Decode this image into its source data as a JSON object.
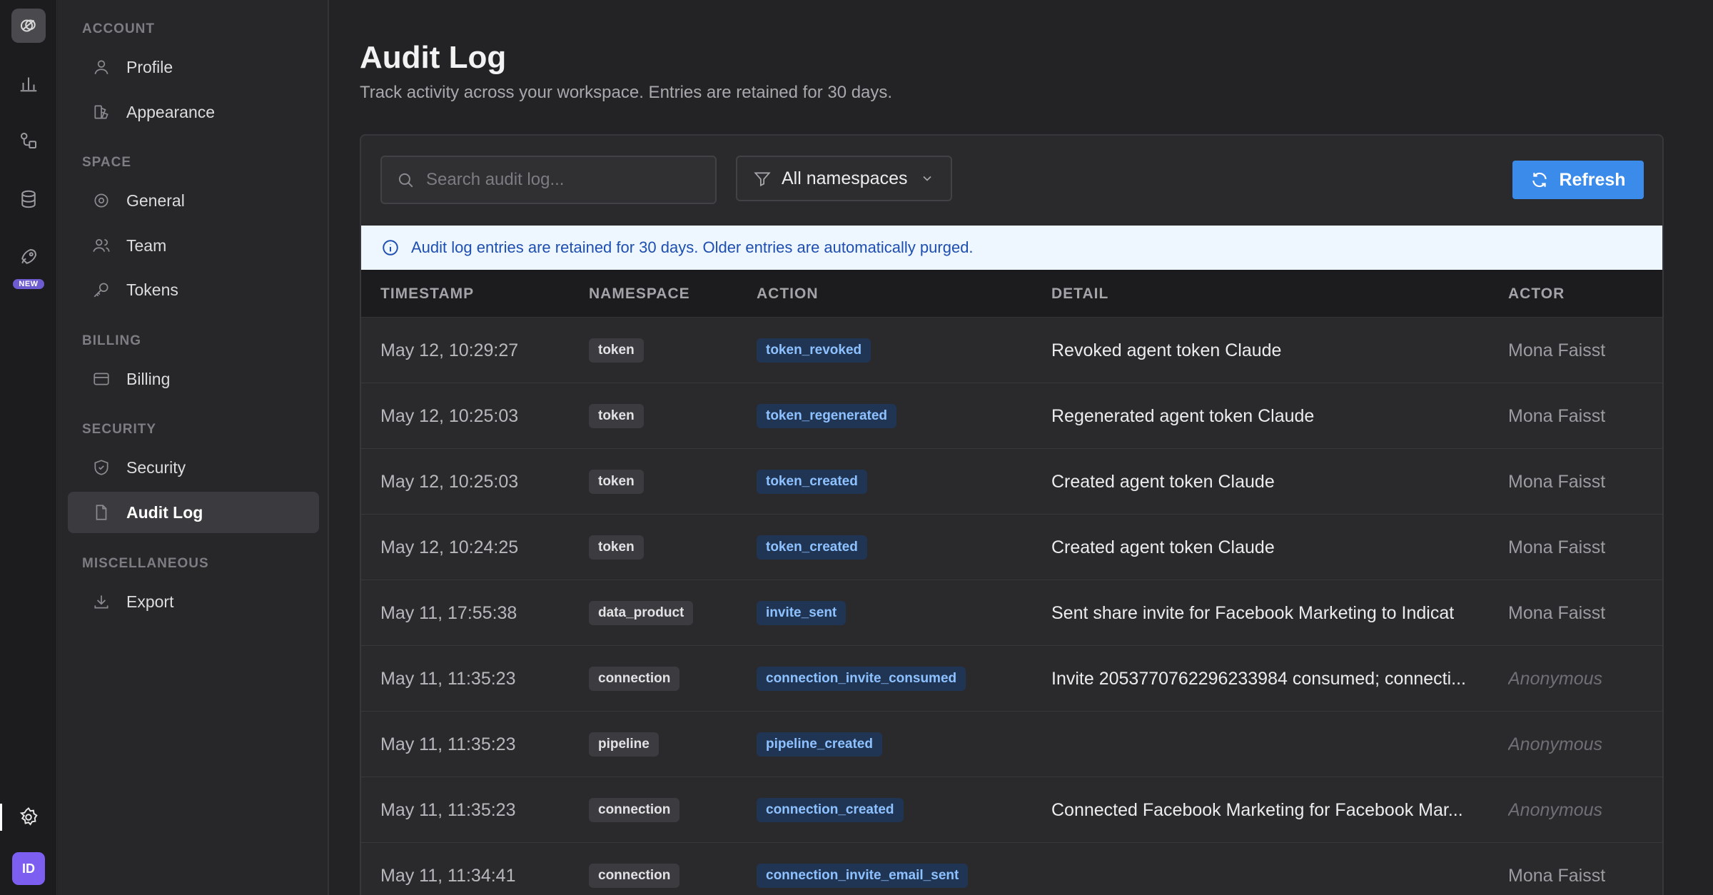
{
  "rail": {
    "new_badge": "NEW",
    "avatar_initials": "ID",
    "icons": [
      "logo-icon",
      "chart-icon",
      "pipeline-icon",
      "database-icon",
      "rocket-icon",
      "gear-icon"
    ]
  },
  "sidebar": {
    "sections": {
      "account": "ACCOUNT",
      "space": "SPACE",
      "billing": "BILLING",
      "security": "SECURITY",
      "misc": "MISCELLANEOUS"
    },
    "items": {
      "profile": "Profile",
      "appearance": "Appearance",
      "general": "General",
      "team": "Team",
      "tokens": "Tokens",
      "billing": "Billing",
      "security": "Security",
      "audit_log": "Audit Log",
      "export": "Export"
    },
    "active": "audit_log"
  },
  "main": {
    "title": "Audit Log",
    "subtitle": "Track activity across your workspace. Entries are retained for 30 days.",
    "search_placeholder": "Search audit log...",
    "namespace_filter": "All namespaces",
    "refresh_label": "Refresh",
    "info_banner": "Audit log entries are retained for 30 days. Older entries are automatically purged.",
    "columns": {
      "timestamp": "TIMESTAMP",
      "namespace": "NAMESPACE",
      "action": "ACTION",
      "detail": "DETAIL",
      "actor": "ACTOR"
    },
    "rows": [
      {
        "timestamp": "May 12, 10:29:27",
        "namespace": "token",
        "action": "token_revoked",
        "detail": "Revoked agent token Claude",
        "actor": "Mona Faisst"
      },
      {
        "timestamp": "May 12, 10:25:03",
        "namespace": "token",
        "action": "token_regenerated",
        "detail": "Regenerated agent token Claude",
        "actor": "Mona Faisst"
      },
      {
        "timestamp": "May 12, 10:25:03",
        "namespace": "token",
        "action": "token_created",
        "detail": "Created agent token Claude",
        "actor": "Mona Faisst"
      },
      {
        "timestamp": "May 12, 10:24:25",
        "namespace": "token",
        "action": "token_created",
        "detail": "Created agent token Claude",
        "actor": "Mona Faisst"
      },
      {
        "timestamp": "May 11, 17:55:38",
        "namespace": "data_product",
        "action": "invite_sent",
        "detail": "Sent share invite for Facebook Marketing to Indicat",
        "actor": "Mona Faisst"
      },
      {
        "timestamp": "May 11, 11:35:23",
        "namespace": "connection",
        "action": "connection_invite_consumed",
        "detail": "Invite 2053770762296233984 consumed; connecti...",
        "actor": "Anonymous"
      },
      {
        "timestamp": "May 11, 11:35:23",
        "namespace": "pipeline",
        "action": "pipeline_created",
        "detail": "",
        "actor": "Anonymous"
      },
      {
        "timestamp": "May 11, 11:35:23",
        "namespace": "connection",
        "action": "connection_created",
        "detail": "Connected Facebook Marketing for Facebook Mar...",
        "actor": "Anonymous"
      },
      {
        "timestamp": "May 11, 11:34:41",
        "namespace": "connection",
        "action": "connection_invite_email_sent",
        "detail": "",
        "actor": "Mona Faisst"
      }
    ]
  }
}
